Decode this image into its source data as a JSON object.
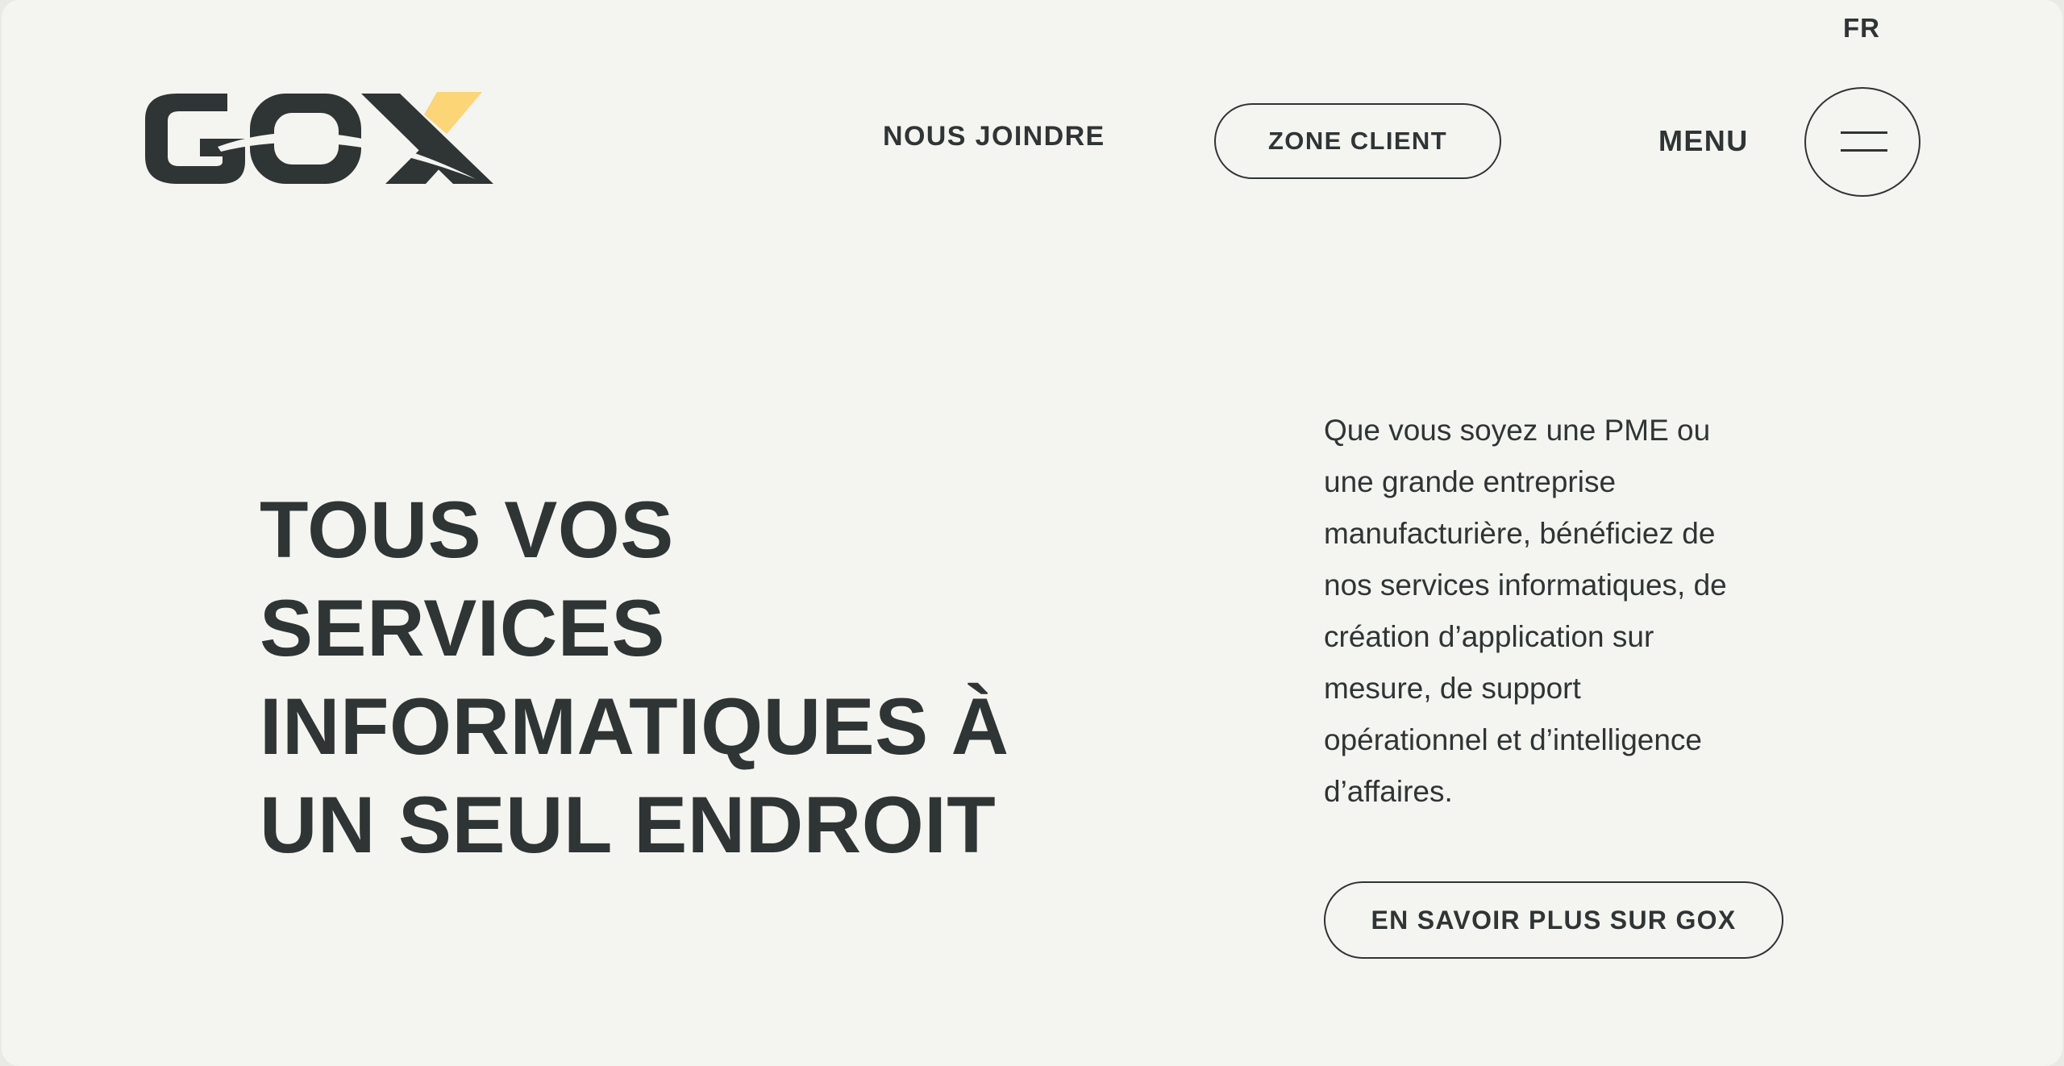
{
  "header": {
    "language": "FR",
    "logo_text": "GOX",
    "nav_link": "NOUS JOINDRE",
    "client_zone_label": "ZONE CLIENT",
    "menu_label": "MENU",
    "menu_icon": "hamburger-icon"
  },
  "hero": {
    "title_lines": [
      "TOUS VOS",
      "SERVICES",
      "INFORMATIQUES À",
      "UN SEUL ENDROIT"
    ],
    "description_lines": [
      "Que vous soyez une PME ou",
      "une grande entreprise",
      "manufacturière, bénéficiez de",
      "nos services informatiques, de",
      "création d’application sur",
      "mesure, de support",
      "opérationnel et d’intelligence",
      "d’affaires."
    ],
    "cta_label": "EN SAVOIR PLUS SUR GOX"
  },
  "colors": {
    "background": "#f4f5f0",
    "text": "#2f3435",
    "accent": "#fcd577"
  }
}
